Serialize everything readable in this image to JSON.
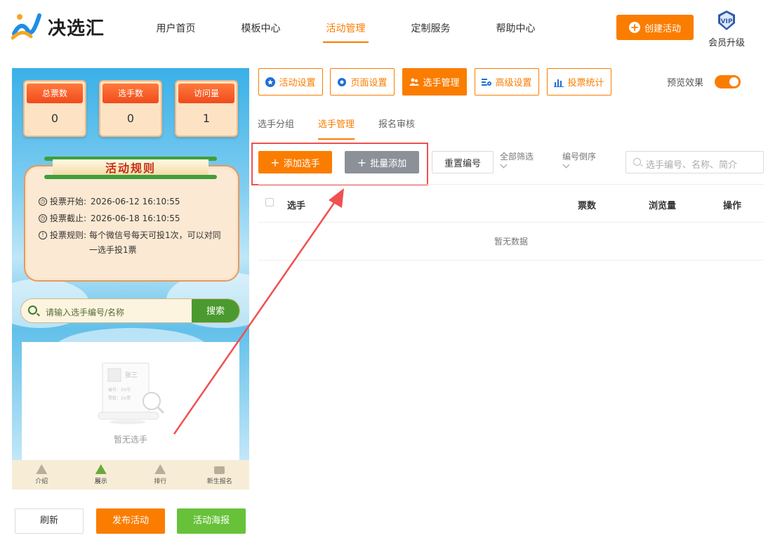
{
  "header": {
    "logo_text": "决选汇",
    "nav": [
      "用户首页",
      "模板中心",
      "活动管理",
      "定制服务",
      "帮助中心"
    ],
    "active_nav": "活动管理",
    "create_label": "创建活动",
    "vip_badge": "VIP",
    "vip_label": "会员升级"
  },
  "preview": {
    "stats": [
      {
        "label": "总票数",
        "value": "0"
      },
      {
        "label": "选手数",
        "value": "0"
      },
      {
        "label": "访问量",
        "value": "1"
      }
    ],
    "rules_title": "活动规则",
    "rules": [
      {
        "icon": "clock-icon",
        "key": "投票开始:",
        "value": "2026-06-12 16:10:55"
      },
      {
        "icon": "clock-icon",
        "key": "投票截止:",
        "value": "2026-06-18 16:10:55"
      },
      {
        "icon": "info-icon",
        "key": "投票规则:",
        "value": "每个微信号每天可投1次，可以对同一选手投1票"
      }
    ],
    "search_placeholder": "请输入选手编号/名称",
    "search_button": "搜索",
    "empty_card_name": "张三",
    "empty_card_line1": "编号：XX号",
    "empty_card_line2": "票数：XX票",
    "empty_text": "暂无选手",
    "tabs": [
      "介绍",
      "展示",
      "排行",
      "新生报名"
    ],
    "active_tab": "展示"
  },
  "bottom_buttons": {
    "refresh": "刷新",
    "publish": "发布活动",
    "poster": "活动海报"
  },
  "toolbar": [
    {
      "label": "活动设置",
      "icon": "star-icon"
    },
    {
      "label": "页面设置",
      "icon": "gear-icon"
    },
    {
      "label": "选手管理",
      "icon": "users-icon"
    },
    {
      "label": "高级设置",
      "icon": "advanced-settings-icon"
    },
    {
      "label": "投票统计",
      "icon": "bar-chart-icon"
    }
  ],
  "active_toolbar": "选手管理",
  "preview_toggle": {
    "label": "预览效果",
    "on": true
  },
  "subtabs": [
    "选手分组",
    "选手管理",
    "报名审核"
  ],
  "active_subtab": "选手管理",
  "actions": {
    "add": "添加选手",
    "batch_add": "批量添加",
    "reset": "重置编号",
    "filter": "全部筛选",
    "sort": "编号倒序",
    "search_placeholder": "选手编号、名称、简介"
  },
  "table": {
    "columns": [
      "选手",
      "票数",
      "浏览量",
      "操作"
    ],
    "empty": "暂无数据"
  },
  "colors": {
    "accent": "#fa7d00",
    "highlight": "#f05050",
    "green": "#67c23a"
  }
}
